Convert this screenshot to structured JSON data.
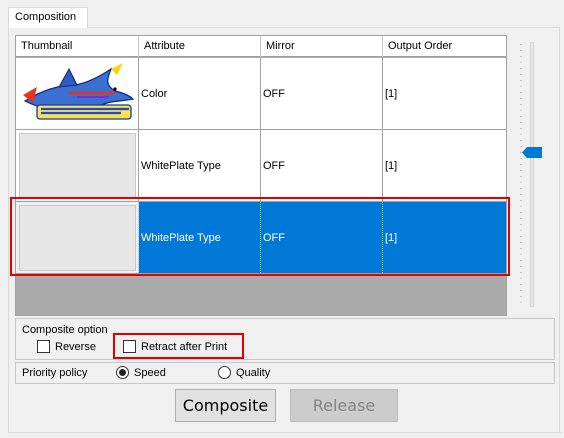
{
  "tab": {
    "label": "Composition"
  },
  "table": {
    "columns": [
      "Thumbnail",
      "Attribute",
      "Mirror",
      "Output Order"
    ],
    "rows": [
      {
        "thumbnail": "marlin-artwork",
        "attribute": "Color",
        "mirror": "OFF",
        "output_order": "[1]",
        "selected": false
      },
      {
        "thumbnail": "blank",
        "attribute": "WhitePlate Type",
        "mirror": "OFF",
        "output_order": "[1]",
        "selected": false
      },
      {
        "thumbnail": "blank",
        "attribute": "WhitePlate Type",
        "mirror": "OFF",
        "output_order": "[1]",
        "selected": true
      }
    ]
  },
  "composite_option": {
    "title": "Composite option",
    "reverse_label": "Reverse",
    "reverse_checked": false,
    "retract_label": "Retract after Print",
    "retract_checked": false
  },
  "priority_policy": {
    "label": "Priority policy",
    "options": [
      "Speed",
      "Quality"
    ],
    "selected": "Speed"
  },
  "buttons": {
    "composite": "Composite",
    "release": "Release"
  },
  "colors": {
    "selection": "#0078d7",
    "highlight": "#e00000",
    "slider_thumb": "#0078d7"
  }
}
